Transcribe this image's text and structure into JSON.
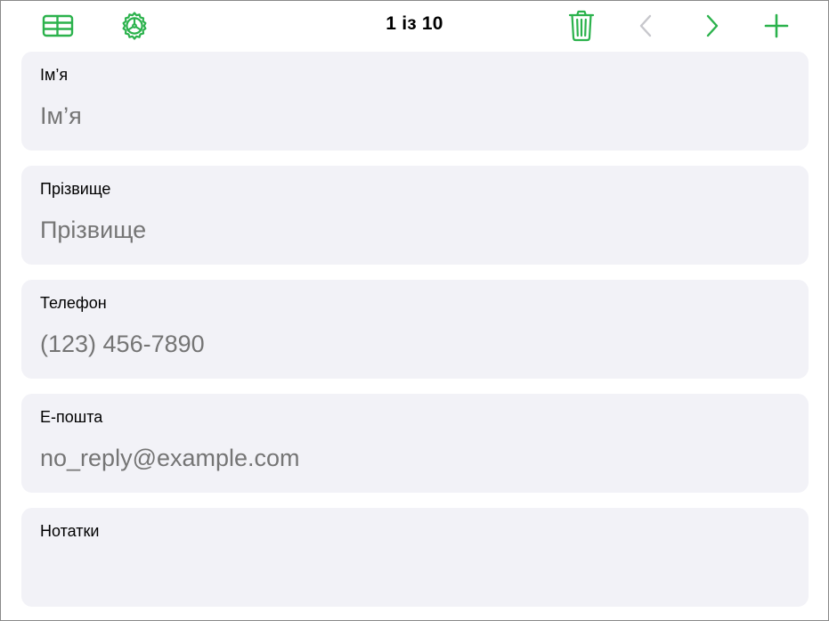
{
  "colors": {
    "accent": "#2bb24c",
    "disabled": "#c7c7cc",
    "card_background": "#f2f2f7"
  },
  "toolbar": {
    "record_count": "1 із 10",
    "icons": [
      "table-view-icon",
      "settings-gear-icon",
      "trash-icon",
      "chevron-left-icon",
      "chevron-right-icon",
      "plus-icon"
    ],
    "previous_enabled": false,
    "next_enabled": true
  },
  "fields": [
    {
      "label": "Ім’я",
      "value": "",
      "placeholder": "Ім’я"
    },
    {
      "label": "Прізвище",
      "value": "",
      "placeholder": "Прізвище"
    },
    {
      "label": "Телефон",
      "value": "",
      "placeholder": "(123) 456-7890"
    },
    {
      "label": "Е-пошта",
      "value": "",
      "placeholder": "no_reply@example.com"
    },
    {
      "label": "Нотатки",
      "value": "",
      "placeholder": ""
    }
  ]
}
